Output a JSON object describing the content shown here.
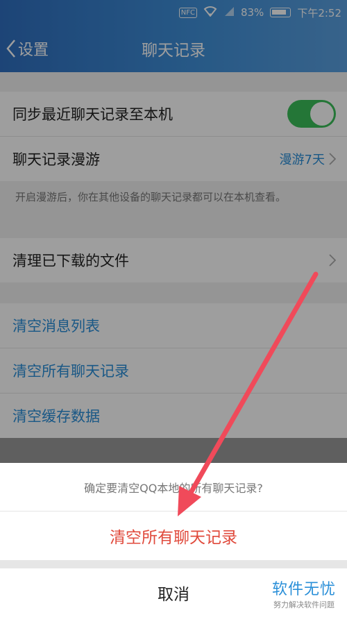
{
  "status_bar": {
    "nfc": "NFC",
    "battery": "83%",
    "time": "下午2:52"
  },
  "header": {
    "back_label": "设置",
    "title": "聊天记录"
  },
  "settings": {
    "sync_label": "同步最近聊天记录至本机",
    "sync_on": true,
    "roaming_label": "聊天记录漫游",
    "roaming_value": "漫游7天",
    "roaming_desc": "开启漫游后，你在其他设备的聊天记录都可以在本机查看。",
    "clean_files_label": "清理已下载的文件",
    "clear_msg_list": "清空消息列表",
    "clear_all_records": "清空所有聊天记录",
    "clear_cache": "清空缓存数据"
  },
  "action_sheet": {
    "message": "确定要清空QQ本地的所有聊天记录?",
    "confirm_label": "清空所有聊天记录",
    "cancel_label": "取消"
  },
  "watermark": {
    "main": "软件无忧",
    "sub": "努力解决软件问题"
  },
  "colors": {
    "accent_blue": "#2a8fd8",
    "toggle_green": "#3bbf5a",
    "danger_red": "#e04a3c",
    "arrow_red": "#f04a5a"
  }
}
